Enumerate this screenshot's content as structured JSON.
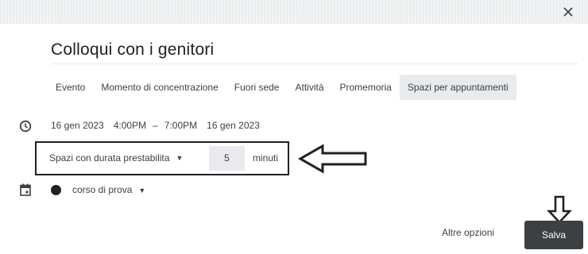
{
  "dialog": {
    "title": "Colloqui con i genitori"
  },
  "tabs": [
    {
      "label": "Evento",
      "active": false
    },
    {
      "label": "Momento di concentrazione",
      "active": false
    },
    {
      "label": "Fuori sede",
      "active": false
    },
    {
      "label": "Attività",
      "active": false
    },
    {
      "label": "Promemoria",
      "active": false
    },
    {
      "label": "Spazi per appuntamenti",
      "active": true
    }
  ],
  "time": {
    "start_date": "16 gen 2023",
    "start_time": "4:00PM",
    "separator": "–",
    "end_time": "7:00PM",
    "end_date": "16 gen 2023"
  },
  "slots": {
    "mode_label": "Spazi con durata prestabilita",
    "duration_value": "5",
    "unit": "minuti"
  },
  "calendar": {
    "name": "corso di prova",
    "color": "#202124"
  },
  "footer": {
    "more_options": "Altre opzioni",
    "save": "Salva"
  },
  "icons": {
    "close": "close-icon",
    "clock": "clock-icon",
    "calendar": "calendar-icon",
    "dropdown": "caret-down-icon"
  },
  "colors": {
    "active_tab_bg": "#e8eaed",
    "save_bg": "#3c4043",
    "text": "#3c4043"
  }
}
